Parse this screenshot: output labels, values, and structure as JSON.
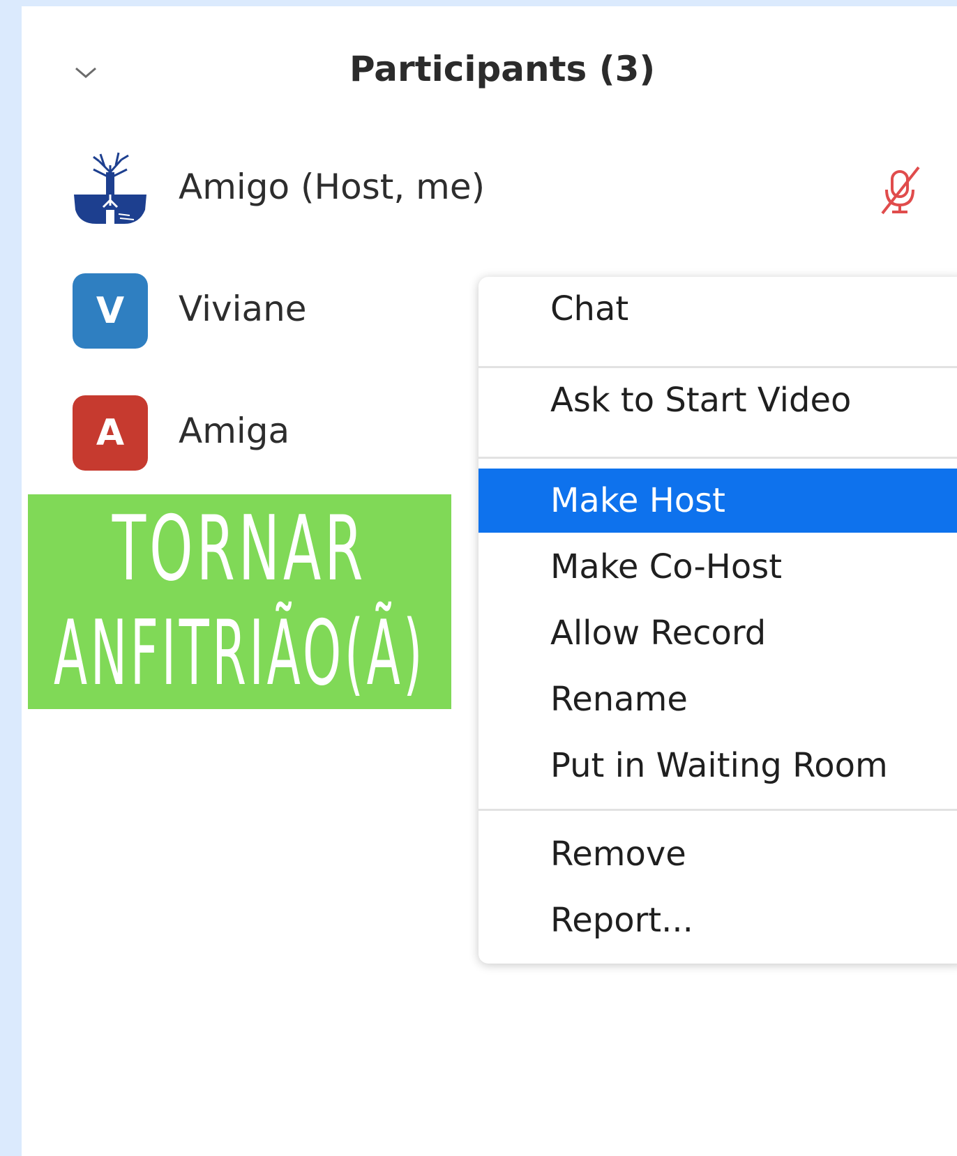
{
  "panel": {
    "title": "Participants (3)"
  },
  "participants": [
    {
      "name": "Amigo (Host, me)",
      "avatar": "logo",
      "mic": "muted-mic-icon"
    },
    {
      "name": "Viviane",
      "avatar": "V",
      "avatar_color": "#2f7fc1"
    },
    {
      "name": "Amiga",
      "avatar": "A",
      "avatar_color": "#c63a2f"
    }
  ],
  "banner": {
    "line1": "TORNAR",
    "line2": "ANFITRIÃO(Ã)",
    "color": "#80d957"
  },
  "menu": {
    "items": [
      {
        "label": "Chat"
      },
      {
        "label": "Ask to Start Video"
      },
      {
        "label": "Make Host",
        "active": true
      },
      {
        "label": "Make Co-Host"
      },
      {
        "label": "Allow Record"
      },
      {
        "label": "Rename"
      },
      {
        "label": "Put in Waiting Room"
      },
      {
        "label": "Remove"
      },
      {
        "label": "Report..."
      }
    ],
    "accent": "#0e72ed"
  }
}
